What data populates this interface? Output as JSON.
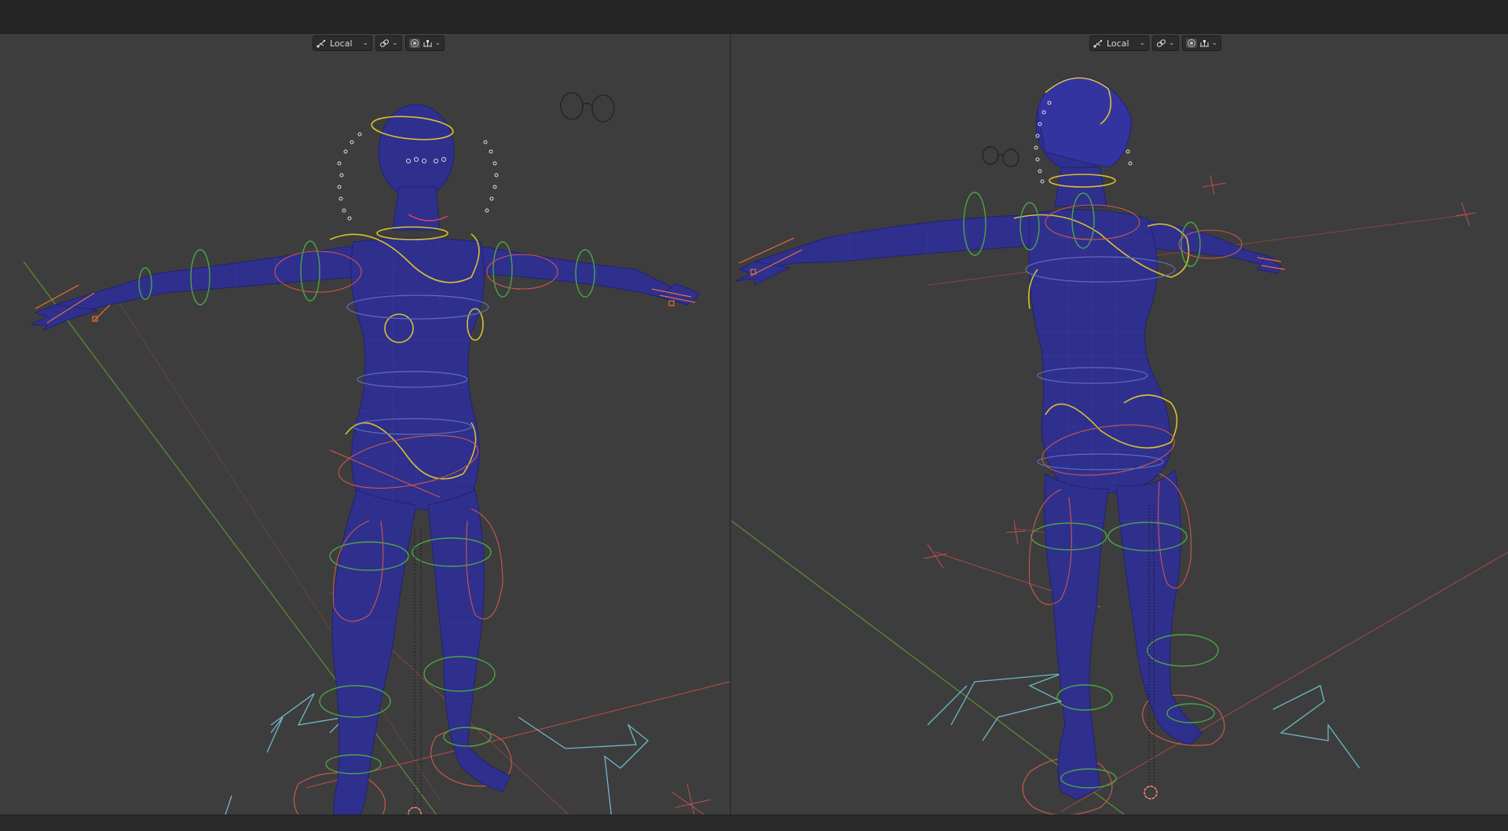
{
  "viewport_left": {
    "pivot": {
      "label": "Local",
      "icon": "transform-pivot-icon"
    },
    "snap_icon": "snap-link-icon",
    "proportional_icon": "proportional-editing-icon",
    "falloff_icon": "falloff-icon"
  },
  "viewport_right": {
    "pivot": {
      "label": "Local",
      "icon": "transform-pivot-icon"
    },
    "snap_icon": "snap-link-icon",
    "proportional_icon": "proportional-editing-icon",
    "falloff_icon": "falloff-icon"
  },
  "colors": {
    "mesh": "#2f2f8e",
    "control_yellow": "#d8c030",
    "control_green": "#4aa548",
    "control_red": "#c85a4e",
    "control_blue": "#5a6fc0",
    "control_cyan": "#6fb8c8",
    "axis_red": "#b04848",
    "axis_green": "#5a8a3a"
  }
}
